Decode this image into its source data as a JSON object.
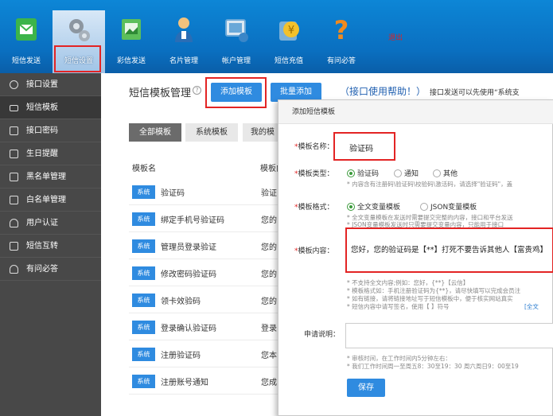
{
  "topnav": {
    "items": [
      {
        "label": "短信发送",
        "icon": "sms-envelope-icon",
        "color": "#3cb44a"
      },
      {
        "label": "短信设置",
        "icon": "settings-gears-icon",
        "color": "#9aa6b2"
      },
      {
        "label": "彩信发送",
        "icon": "mms-picture-icon",
        "color": "#4caf50"
      },
      {
        "label": "名片管理",
        "icon": "business-card-person-icon",
        "color": "#2a6db5"
      },
      {
        "label": "帐户管理",
        "icon": "account-monitor-icon",
        "color": "#6aa8d8"
      },
      {
        "label": "短信充值",
        "icon": "recharge-coin-icon",
        "color": "#e8b423"
      },
      {
        "label": "有问必答",
        "icon": "question-mark-icon",
        "color": "#f08a1e"
      }
    ],
    "logout": "退出"
  },
  "sidebar": {
    "items": [
      {
        "label": "接口设置",
        "icon": "gear-icon"
      },
      {
        "label": "短信模板",
        "icon": "envelope-icon"
      },
      {
        "label": "接口密码",
        "icon": "clipboard-check-icon"
      },
      {
        "label": "生日提醒",
        "icon": "calendar-icon"
      },
      {
        "label": "黑名单管理",
        "icon": "clipboard-x-icon"
      },
      {
        "label": "白名单管理",
        "icon": "clipboard-check-icon"
      },
      {
        "label": "用户认证",
        "icon": "user-icon"
      },
      {
        "label": "短信互转",
        "icon": "edit-icon"
      },
      {
        "label": "有问必答",
        "icon": "user-icon"
      }
    ]
  },
  "main": {
    "title": "短信模板管理",
    "help_icon": "?",
    "add_button": "添加模板",
    "batch_button": "批量添加",
    "help_link": "（接口使用帮助！）",
    "help_text": "接口发送可以先使用“系统支",
    "tabs": [
      "全部模板",
      "系统模板",
      "我的模"
    ],
    "col_name": "模板名",
    "col_content": "模板内",
    "rows": [
      {
        "badge": "系统",
        "name": "验证码",
        "preview": "验证"
      },
      {
        "badge": "系统",
        "name": "绑定手机号验证码",
        "preview": "您的"
      },
      {
        "badge": "系统",
        "name": "管理员登录验证",
        "preview": "您的"
      },
      {
        "badge": "系统",
        "name": "修改密码验证码",
        "preview": "您的"
      },
      {
        "badge": "系统",
        "name": "领卡效验码",
        "preview": "您的"
      },
      {
        "badge": "系统",
        "name": "登录确认验证码",
        "preview": "登录"
      },
      {
        "badge": "系统",
        "name": "注册验证码",
        "preview": "您本"
      },
      {
        "badge": "系统",
        "name": "注册账号通知",
        "preview": "您成"
      }
    ]
  },
  "dialog": {
    "title": "添加短信模板",
    "name_label": "模板名称：",
    "name_value": "验证码",
    "type_label": "模板类型：",
    "type_options": [
      "验证码",
      "通知",
      "其他"
    ],
    "type_hint": "* 内容含有注册码\\验证码\\校验码\\激活码，请选择\"验证码\"，盖",
    "format_label": "模板格式：",
    "format_options": [
      "全文变量模板",
      "JSON变量模板"
    ],
    "format_hints": [
      "* 全文变量模板在发送时需要提交完整的内容，接口和平台发送",
      "* JSON变量模板发送时只需要提交变量内容，只能用于接口"
    ],
    "content_label": "模板内容：",
    "content_value": "您好，您的验证码是【**】打死不要告诉其他人【富贵鸡】",
    "content_hints": [
      "* 不支持全文内容;例如：您好，{**}【云信】",
      "* 模板格式如：手机注册验证码为{**}，请尽快填写以完成会员注",
      "* 如有链接，请将链接地址写于短信模板中，便于核实网站真实",
      "* 短信内容中请写签名，使用【 】符号"
    ],
    "content_hint_link": "[全文",
    "apply_label": "申请说明：",
    "review_hints": [
      "* 审核时间，在工作时间内5分钟左右：",
      "* 我们工作时间周一至周五8：30至19：30 周六周日9：00至19"
    ],
    "save_button": "保存"
  }
}
